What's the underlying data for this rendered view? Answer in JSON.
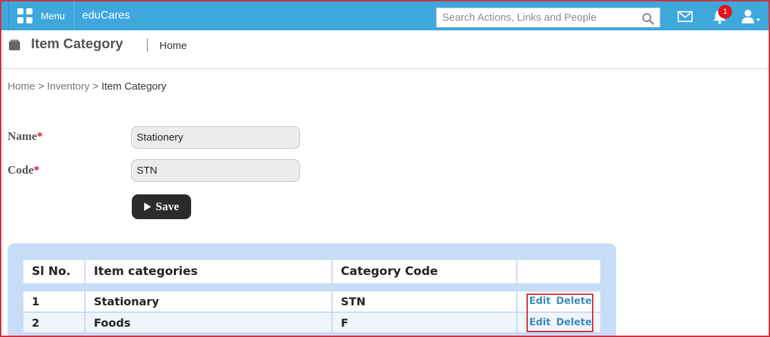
{
  "topbar": {
    "menu_label": "Menu",
    "brand": "eduCares",
    "search_placeholder": "Search Actions, Links and People",
    "notifications_count": "1",
    "colors": {
      "bar": "#3ea7dc",
      "badge": "#e2131c"
    }
  },
  "header": {
    "title": "Item Category",
    "home_link": "Home"
  },
  "breadcrumb": {
    "home": "Home",
    "sep1": ">",
    "inventory": "Inventory",
    "sep2": ">",
    "current": "Item Category"
  },
  "form": {
    "name_label": "Name",
    "name_value": "Stationery",
    "code_label": "Code",
    "code_value": "STN",
    "required_mark": "*",
    "save_label": "Save"
  },
  "table": {
    "headers": [
      "Sl No.",
      "Item categories",
      "Category Code",
      ""
    ],
    "rows": [
      {
        "sl": "1",
        "category": "Stationary",
        "code": "STN",
        "edit": "Edit",
        "delete": "Delete"
      },
      {
        "sl": "2",
        "category": "Foods",
        "code": "F",
        "edit": "Edit",
        "delete": "Delete"
      }
    ]
  }
}
